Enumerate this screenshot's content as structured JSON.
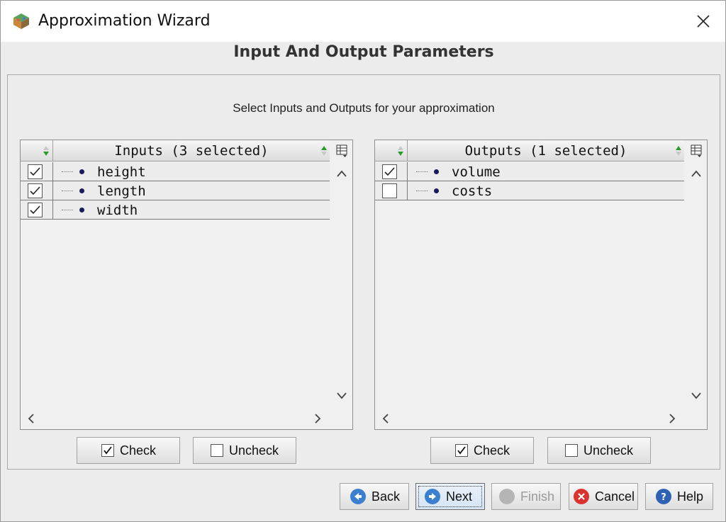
{
  "window": {
    "title": "Approximation Wizard"
  },
  "page_heading": "Input And Output Parameters",
  "instruction": "Select Inputs and Outputs for your approximation",
  "inputs": {
    "header": "Inputs (3 selected)",
    "rows": [
      {
        "label": "height",
        "checked": true
      },
      {
        "label": "length",
        "checked": true
      },
      {
        "label": "width",
        "checked": true
      }
    ],
    "check_label": "Check",
    "uncheck_label": "Uncheck"
  },
  "outputs": {
    "header": "Outputs (1 selected)",
    "rows": [
      {
        "label": "volume",
        "checked": true
      },
      {
        "label": "costs",
        "checked": false
      }
    ],
    "check_label": "Check",
    "uncheck_label": "Uncheck"
  },
  "footer": {
    "back_label": "Back",
    "next_label": "Next",
    "finish_label": "Finish",
    "cancel_label": "Cancel",
    "help_label": "Help"
  },
  "colors": {
    "back_icon": "#3a7fd0",
    "next_icon": "#3a7fd0",
    "finish_icon": "#b5b5b5",
    "cancel_icon": "#d9322f",
    "help_icon": "#2f62b5",
    "sort_arrow": "#2a9a2a"
  }
}
